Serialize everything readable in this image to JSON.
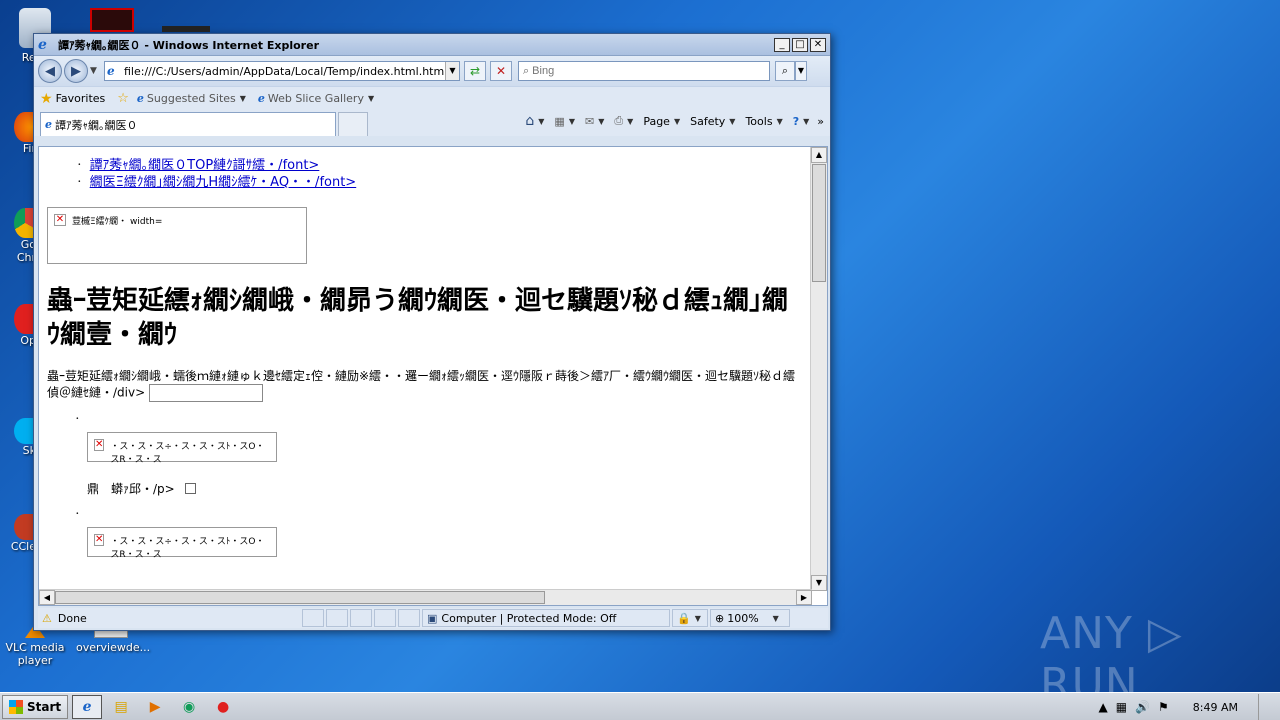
{
  "desktop": {
    "icons": [
      {
        "label": "Recy"
      },
      {
        "label": "Fir"
      },
      {
        "label": "Go Chr"
      },
      {
        "label": "Op"
      },
      {
        "label": "Sk"
      },
      {
        "label": "CCle"
      },
      {
        "label": "VLC media player"
      },
      {
        "label": "overviewde..."
      }
    ]
  },
  "window": {
    "title": "譚ｱ莠ｬ繝｡繝医０ - Windows Internet Explorer",
    "controls": {
      "minimize": "_",
      "maximize": "□",
      "close": "✕"
    }
  },
  "address": {
    "url": "file:///C:/Users/admin/AppData/Local/Temp/index.html.htm?fnam",
    "search_placeholder": "Bing"
  },
  "favorites": {
    "favorites_label": "Favorites",
    "suggested_sites": "Suggested Sites",
    "web_slice_gallery": "Web Slice Gallery"
  },
  "tab": {
    "title": "譚ｱ莠ｬ繝｡繝医０"
  },
  "commandbar": {
    "page": "Page",
    "safety": "Safety",
    "tools": "Tools"
  },
  "content": {
    "links": [
      "譚ｱ莠ｬ繝｡繝医０TOP縺ｸ謌ｻ繧・/font>",
      "繝医Ξ繧ｸ繝｣繝ｼ繝九Η繝ｼ繧ｹ・AQ・・/font>"
    ],
    "broken_image_1": "荳槭Ξ繧ｹ繝・ width=",
    "heading": "蟲ｰ荳矩延繧ｫ繝ｼ繝峨・繝昴う繝ｳ繝医・迴セ驥題ｿ秘ｄ繧ｭ繝｣繝ｳ繝壹・繝ｳ",
    "paragraph": "蟲ｰ荳矩延繧ｫ繝ｼ繝峨・蠕後ｍ縺ｫ縺ゅｋ邊ｾ繧定ｪ倥・縺励※繧・・邏ー繝ｫ繧ｯ繝医・逕ｳ隱阪ｒ蒔後＞繧ｱ厂・繧ｳ繝ｳ繝医・迴セ驥題ｿ秘ｄ繧偵＠縺ｾ縺・/div>",
    "bullet": "·",
    "broken_image_2": "・ス・ス・ス÷・ス・ス・スﾄ・スO・スR・ス・ス",
    "caption": "鼎　蟒ｧ邱・/p>",
    "broken_image_3": "・ス・ス・ス÷・ス・ス・スﾄ・スO・スR・ス・ス"
  },
  "status": {
    "text": "Done",
    "zone": "Computer | Protected Mode: Off",
    "zoom": "100%"
  },
  "taskbar": {
    "start": "Start",
    "clock": "8:49 AM"
  },
  "watermark": "ANY ▷ RUN"
}
